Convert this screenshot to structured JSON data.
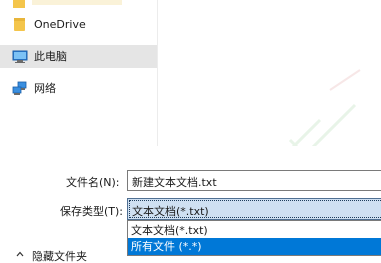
{
  "nav": {
    "items": [
      {
        "label": "OneDrive",
        "icon": "folder-icon",
        "selected": false
      },
      {
        "label": "此电脑",
        "icon": "computer-icon",
        "selected": true
      },
      {
        "label": "网络",
        "icon": "network-icon",
        "selected": false
      }
    ]
  },
  "form": {
    "filename_label": "文件名(N):",
    "filename_value": "新建文本文档.txt",
    "filetype_label": "保存类型(T):",
    "filetype_value": "文本文档(*.txt)",
    "filetype_options": [
      {
        "label": "文本文档(*.txt)",
        "highlighted": false
      },
      {
        "label": "所有文件 (*.*)",
        "highlighted": true
      }
    ]
  },
  "footer": {
    "hide_folders_label": "隐藏文件夹"
  },
  "colors": {
    "selection_blue": "#0078d7",
    "nav_selected": "#e5e5e5",
    "combo_focus": "#cfe0f2",
    "folder_yellow": "#f4c54b"
  }
}
